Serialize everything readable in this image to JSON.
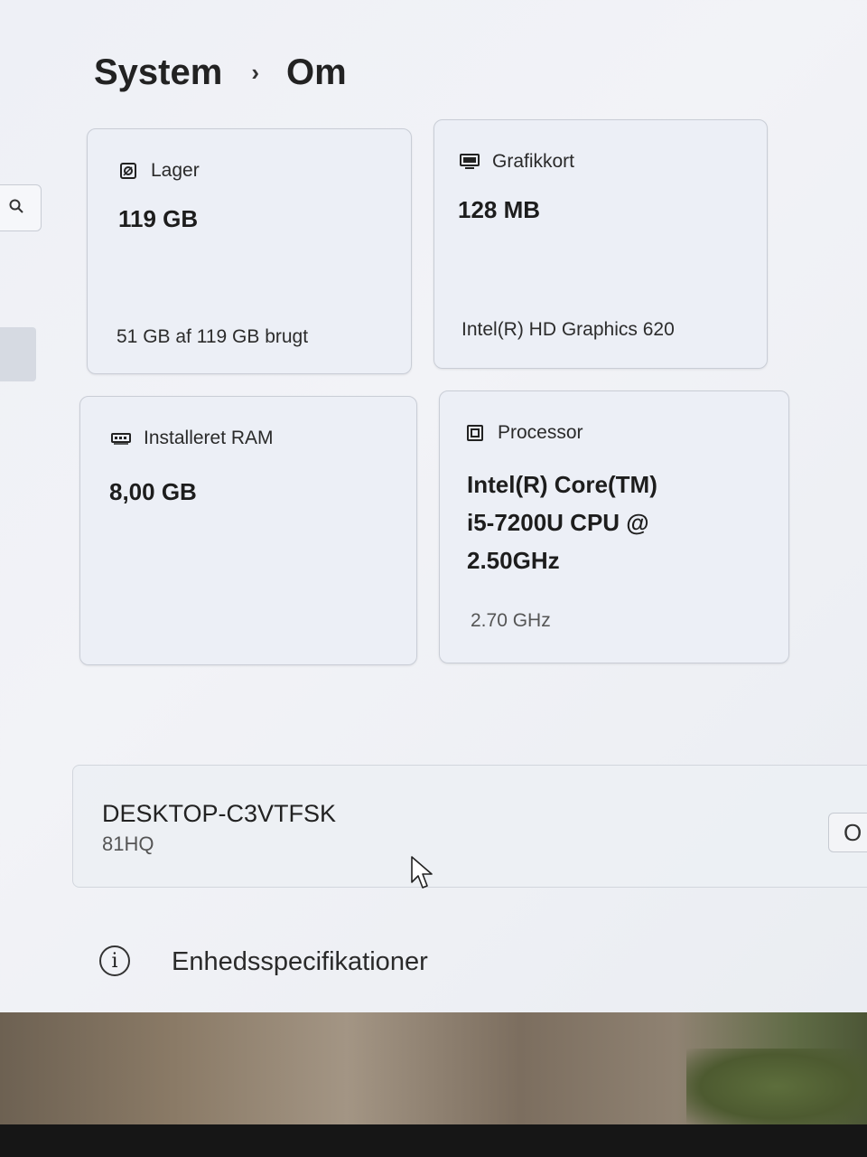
{
  "breadcrumb": {
    "parent": "System",
    "separator": "›",
    "current": "Om"
  },
  "cards": {
    "storage": {
      "title": "Lager",
      "value": "119 GB",
      "detail": "51 GB af 119 GB brugt"
    },
    "graphics": {
      "title": "Grafikkort",
      "value": "128 MB",
      "detail": "Intel(R) HD Graphics 620"
    },
    "ram": {
      "title": "Installeret RAM",
      "value": "8,00 GB"
    },
    "processor": {
      "title": "Processor",
      "value_lines": [
        "Intel(R) Core(TM)",
        "i5-7200U CPU @",
        "2.50GHz"
      ],
      "detail": "2.70 GHz"
    }
  },
  "device": {
    "name": "DESKTOP-C3VTFSK",
    "model": "81HQ",
    "rename_button": "O"
  },
  "specs": {
    "label": "Enhedsspecifikationer",
    "icon_glyph": "i"
  },
  "icons": {
    "search": "search-icon",
    "storage": "drive-icon",
    "graphics": "monitor-icon",
    "ram": "memory-icon",
    "processor": "cpu-icon",
    "info": "info-icon",
    "cursor": "mouse-pointer-icon"
  }
}
